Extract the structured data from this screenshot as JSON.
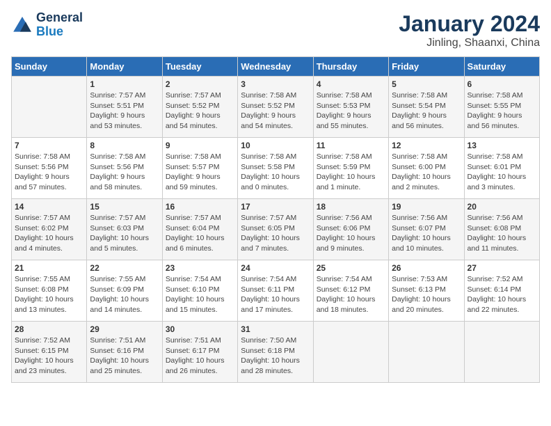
{
  "header": {
    "logo_line1": "General",
    "logo_line2": "Blue",
    "month_year": "January 2024",
    "location": "Jinling, Shaanxi, China"
  },
  "days_of_week": [
    "Sunday",
    "Monday",
    "Tuesday",
    "Wednesday",
    "Thursday",
    "Friday",
    "Saturday"
  ],
  "weeks": [
    [
      {
        "day": "",
        "info": ""
      },
      {
        "day": "1",
        "info": "Sunrise: 7:57 AM\nSunset: 5:51 PM\nDaylight: 9 hours\nand 53 minutes."
      },
      {
        "day": "2",
        "info": "Sunrise: 7:57 AM\nSunset: 5:52 PM\nDaylight: 9 hours\nand 54 minutes."
      },
      {
        "day": "3",
        "info": "Sunrise: 7:58 AM\nSunset: 5:52 PM\nDaylight: 9 hours\nand 54 minutes."
      },
      {
        "day": "4",
        "info": "Sunrise: 7:58 AM\nSunset: 5:53 PM\nDaylight: 9 hours\nand 55 minutes."
      },
      {
        "day": "5",
        "info": "Sunrise: 7:58 AM\nSunset: 5:54 PM\nDaylight: 9 hours\nand 56 minutes."
      },
      {
        "day": "6",
        "info": "Sunrise: 7:58 AM\nSunset: 5:55 PM\nDaylight: 9 hours\nand 56 minutes."
      }
    ],
    [
      {
        "day": "7",
        "info": "Sunrise: 7:58 AM\nSunset: 5:56 PM\nDaylight: 9 hours\nand 57 minutes."
      },
      {
        "day": "8",
        "info": "Sunrise: 7:58 AM\nSunset: 5:56 PM\nDaylight: 9 hours\nand 58 minutes."
      },
      {
        "day": "9",
        "info": "Sunrise: 7:58 AM\nSunset: 5:57 PM\nDaylight: 9 hours\nand 59 minutes."
      },
      {
        "day": "10",
        "info": "Sunrise: 7:58 AM\nSunset: 5:58 PM\nDaylight: 10 hours\nand 0 minutes."
      },
      {
        "day": "11",
        "info": "Sunrise: 7:58 AM\nSunset: 5:59 PM\nDaylight: 10 hours\nand 1 minute."
      },
      {
        "day": "12",
        "info": "Sunrise: 7:58 AM\nSunset: 6:00 PM\nDaylight: 10 hours\nand 2 minutes."
      },
      {
        "day": "13",
        "info": "Sunrise: 7:58 AM\nSunset: 6:01 PM\nDaylight: 10 hours\nand 3 minutes."
      }
    ],
    [
      {
        "day": "14",
        "info": "Sunrise: 7:57 AM\nSunset: 6:02 PM\nDaylight: 10 hours\nand 4 minutes."
      },
      {
        "day": "15",
        "info": "Sunrise: 7:57 AM\nSunset: 6:03 PM\nDaylight: 10 hours\nand 5 minutes."
      },
      {
        "day": "16",
        "info": "Sunrise: 7:57 AM\nSunset: 6:04 PM\nDaylight: 10 hours\nand 6 minutes."
      },
      {
        "day": "17",
        "info": "Sunrise: 7:57 AM\nSunset: 6:05 PM\nDaylight: 10 hours\nand 7 minutes."
      },
      {
        "day": "18",
        "info": "Sunrise: 7:56 AM\nSunset: 6:06 PM\nDaylight: 10 hours\nand 9 minutes."
      },
      {
        "day": "19",
        "info": "Sunrise: 7:56 AM\nSunset: 6:07 PM\nDaylight: 10 hours\nand 10 minutes."
      },
      {
        "day": "20",
        "info": "Sunrise: 7:56 AM\nSunset: 6:08 PM\nDaylight: 10 hours\nand 11 minutes."
      }
    ],
    [
      {
        "day": "21",
        "info": "Sunrise: 7:55 AM\nSunset: 6:08 PM\nDaylight: 10 hours\nand 13 minutes."
      },
      {
        "day": "22",
        "info": "Sunrise: 7:55 AM\nSunset: 6:09 PM\nDaylight: 10 hours\nand 14 minutes."
      },
      {
        "day": "23",
        "info": "Sunrise: 7:54 AM\nSunset: 6:10 PM\nDaylight: 10 hours\nand 15 minutes."
      },
      {
        "day": "24",
        "info": "Sunrise: 7:54 AM\nSunset: 6:11 PM\nDaylight: 10 hours\nand 17 minutes."
      },
      {
        "day": "25",
        "info": "Sunrise: 7:54 AM\nSunset: 6:12 PM\nDaylight: 10 hours\nand 18 minutes."
      },
      {
        "day": "26",
        "info": "Sunrise: 7:53 AM\nSunset: 6:13 PM\nDaylight: 10 hours\nand 20 minutes."
      },
      {
        "day": "27",
        "info": "Sunrise: 7:52 AM\nSunset: 6:14 PM\nDaylight: 10 hours\nand 22 minutes."
      }
    ],
    [
      {
        "day": "28",
        "info": "Sunrise: 7:52 AM\nSunset: 6:15 PM\nDaylight: 10 hours\nand 23 minutes."
      },
      {
        "day": "29",
        "info": "Sunrise: 7:51 AM\nSunset: 6:16 PM\nDaylight: 10 hours\nand 25 minutes."
      },
      {
        "day": "30",
        "info": "Sunrise: 7:51 AM\nSunset: 6:17 PM\nDaylight: 10 hours\nand 26 minutes."
      },
      {
        "day": "31",
        "info": "Sunrise: 7:50 AM\nSunset: 6:18 PM\nDaylight: 10 hours\nand 28 minutes."
      },
      {
        "day": "",
        "info": ""
      },
      {
        "day": "",
        "info": ""
      },
      {
        "day": "",
        "info": ""
      }
    ]
  ]
}
